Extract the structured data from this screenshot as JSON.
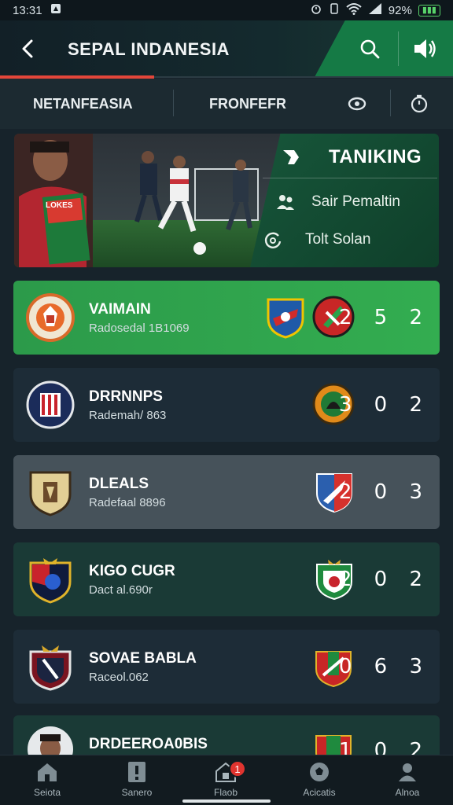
{
  "status_bar": {
    "time": "13:31",
    "battery": "92%"
  },
  "header": {
    "title": "SEPAL INDANESIA"
  },
  "tabs": {
    "tab1": "NETANFEASIA",
    "tab2": "FRONFEFR"
  },
  "banner": {
    "ranking": "TANIKING",
    "item1": "Sair Pemaltin",
    "item2": "Tolt Solan",
    "badge_text": "LOKES"
  },
  "matches": [
    {
      "team": "VAIMAIN",
      "sub": "Radosedal 1B1069",
      "score": "2 5 2",
      "style": "green"
    },
    {
      "team": "DRRNNPS",
      "sub": "Rademah/ 863",
      "score": "3 0 2",
      "style": "navy"
    },
    {
      "team": "DLEALS",
      "sub": "Radefaal 8896",
      "score": "2 0 3",
      "style": "grey"
    },
    {
      "team": "KIGO CUGR",
      "sub": "Dact al.690r",
      "score": "2 0 2",
      "style": "teal"
    },
    {
      "team": "SOVAE BABLA",
      "sub": "Raceol.062",
      "score": "0 6 3",
      "style": "navy"
    },
    {
      "team": "DRDEEROA0BIS",
      "sub": "",
      "score": "1 0 2",
      "style": "teal"
    }
  ],
  "nav": [
    {
      "label": "Seiota",
      "icon": "home-icon"
    },
    {
      "label": "Sanero",
      "icon": "alert-icon"
    },
    {
      "label": "Flaob",
      "icon": "calendar-icon",
      "badge": "1"
    },
    {
      "label": "Acicatis",
      "icon": "ball-icon"
    },
    {
      "label": "Alnoa",
      "icon": "profile-icon"
    }
  ],
  "colors": {
    "accent_red": "#e3463a",
    "brand_green": "#157a45",
    "card_green": "#33ad50",
    "background": "#17232b"
  }
}
